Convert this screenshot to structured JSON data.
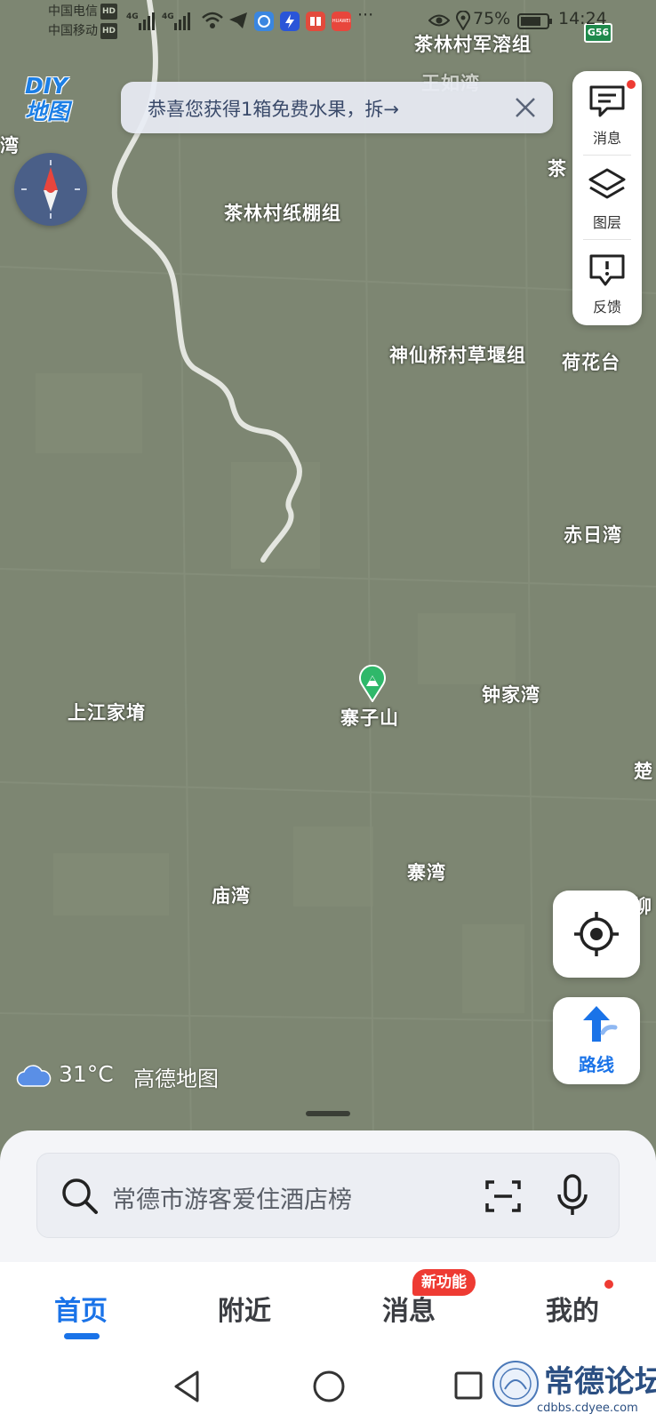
{
  "status_bar": {
    "carrier1": "中国电信",
    "carrier2": "中国移动",
    "hd": "HD",
    "network": "4G",
    "battery": "75%",
    "time": "14:24",
    "notification_app_badge": "HUAWEI"
  },
  "map": {
    "logo_line1": "DIY",
    "logo_line2": "地图",
    "highway_label": "G56",
    "places": [
      "茶林村军溶组",
      "王如湾",
      "湾",
      "茶林村纸棚组",
      "神仙桥村草堰组",
      "荷花台",
      "赤日湾",
      "上江家堉",
      "寨子山",
      "钟家湾",
      "楚",
      "寨湾",
      "庙湾",
      "柳",
      "茶",
      "家湾"
    ]
  },
  "banner": {
    "text": "恭喜您获得1箱免费水果，拆→"
  },
  "tools": {
    "message": "消息",
    "layers": "图层",
    "feedback": "反馈"
  },
  "route": {
    "label": "路线"
  },
  "weather": {
    "temperature": "31°C",
    "brand": "高德地图"
  },
  "search": {
    "placeholder": "常德市游客爱住酒店榜"
  },
  "tabs": {
    "home": "首页",
    "nearby": "附近",
    "messages": "消息",
    "messages_badge": "新功能",
    "mine": "我的"
  },
  "watermark": {
    "title": "常德论坛",
    "url": "cdbbs.cdyee.com"
  },
  "colors": {
    "accent": "#1a73e8",
    "map_bg": "#7d8672",
    "badge_red": "#ee3b33",
    "compass_bg": "#4a5f88"
  }
}
